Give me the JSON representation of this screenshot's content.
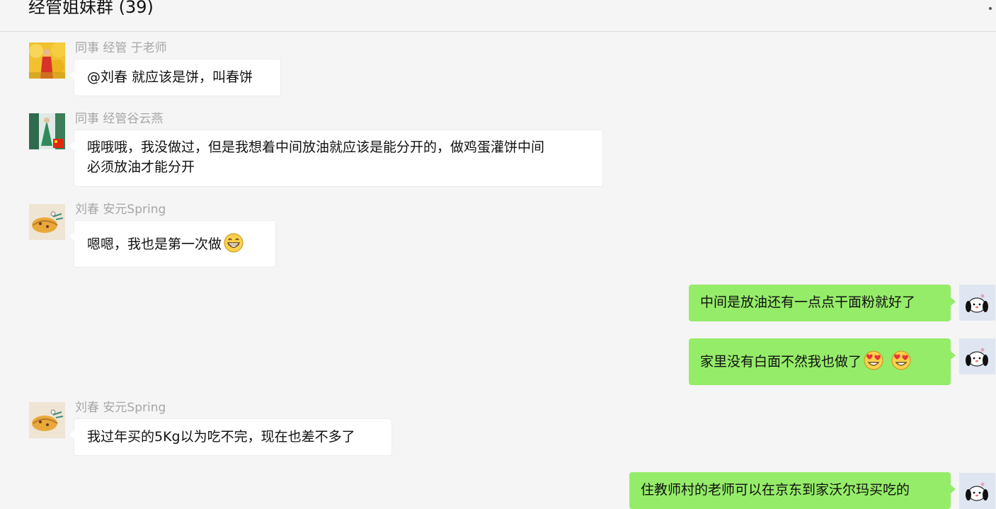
{
  "header": {
    "title": "经管姐妹群 (39)"
  },
  "messages": [
    {
      "sender": "同事 经管 于老师",
      "text": "@刘春 就应该是饼，叫春饼"
    },
    {
      "sender": "同事 经管谷云燕",
      "lines": [
        "哦哦哦，我没做过，但是我想着中间放油就应该是能分开的，做鸡蛋灌饼中间",
        "必须放油才能分开"
      ]
    },
    {
      "sender": "刘春  安元Spring",
      "text": "嗯嗯，我也是第一次做",
      "emoji": "grinning-face-emoji"
    },
    {
      "text": "中间是放油还有一点点干面粉就好了"
    },
    {
      "text": "家里没有白面不然我也做了",
      "emoji": "heart-eyes-emoji"
    },
    {
      "sender": "刘春  安元Spring",
      "text": "我过年买的5Kg以为吃不完，现在也差不多了"
    },
    {
      "text": "住教师村的老师可以在京东到家沃尔玛买吃的"
    }
  ],
  "colors": {
    "self_bubble": "#95ec69",
    "other_bubble": "#ffffff",
    "background": "#f5f5f5"
  }
}
